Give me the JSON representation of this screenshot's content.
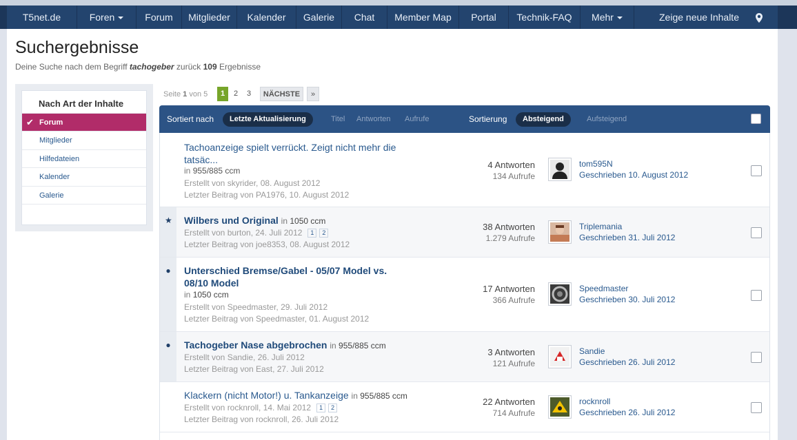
{
  "nav": {
    "items": [
      {
        "label": "T5net.de",
        "caret": false
      },
      {
        "label": "Foren",
        "caret": true
      },
      {
        "label": "Forum",
        "caret": false
      },
      {
        "label": "Mitglieder",
        "caret": false
      },
      {
        "label": "Kalender",
        "caret": false
      },
      {
        "label": "Galerie",
        "caret": false
      },
      {
        "label": "Chat",
        "caret": false
      },
      {
        "label": "Member Map",
        "caret": false
      },
      {
        "label": "Portal",
        "caret": false
      },
      {
        "label": "Technik-FAQ",
        "caret": false
      },
      {
        "label": "Mehr",
        "caret": true
      }
    ],
    "new_content": "Zeige neue Inhalte",
    "location_icon": "map-marker-icon"
  },
  "page": {
    "title": "Suchergebnisse",
    "sub_prefix": "Deine Suche nach dem Begriff",
    "term": "tachogeber",
    "sub_mid": "zurück",
    "count": "109",
    "sub_suffix": "Ergebnisse"
  },
  "sidebar": {
    "title": "Nach Art der Inhalte",
    "items": [
      "Forum",
      "Mitglieder",
      "Hilfedateien",
      "Kalender",
      "Galerie"
    ],
    "active_index": 0
  },
  "pagination": {
    "label_prefix": "Seite",
    "current": "1",
    "label_mid": "von",
    "total": "5",
    "pages": [
      "1",
      "2",
      "3"
    ],
    "next": "NÄCHSTE",
    "last": "»"
  },
  "sort": {
    "label": "Sortiert nach",
    "active": "Letzte Aktualisierung",
    "options": [
      "Titel",
      "Antworten",
      "Aufrufe"
    ],
    "order_label": "Sortierung",
    "order_active": "Absteigend",
    "order_other": "Aufsteigend"
  },
  "results": [
    {
      "title": "Tachoanzeige spielt verrückt. Zeigt nicht mehr die tatsäc...",
      "bold": false,
      "forum_prefix": "in",
      "forum": "955/885 ccm",
      "created": "Erstellt von skyrider, 08. August 2012",
      "last": "Letzter Beitrag von PA1976, 10. August 2012",
      "answers": "4 Antworten",
      "views": "134 Aufrufe",
      "user": "tom595N",
      "date": "Geschrieben 10. August 2012",
      "marker": "",
      "pages": []
    },
    {
      "title": "Wilbers und Original",
      "bold": true,
      "forum_prefix": "in",
      "forum": "1050 ccm",
      "created": "Erstellt von burton, 24. Juli 2012",
      "last": "Letzter Beitrag von joe8353, 08. August 2012",
      "answers": "38 Antworten",
      "views": "1.279 Aufrufe",
      "user": "Triplemania",
      "date": "Geschrieben 31. Juli 2012",
      "marker": "★",
      "pages": [
        "1",
        "2"
      ]
    },
    {
      "title": "Unterschied Bremse/Gabel - 05/07 Model vs. 08/10 Model",
      "bold": true,
      "forum_prefix": "in",
      "forum": "1050 ccm",
      "created": "Erstellt von Speedmaster, 29. Juli 2012",
      "last": "Letzter Beitrag von Speedmaster, 01. August 2012",
      "answers": "17 Antworten",
      "views": "366 Aufrufe",
      "user": "Speedmaster",
      "date": "Geschrieben 30. Juli 2012",
      "marker": "●",
      "pages": []
    },
    {
      "title": "Tachogeber Nase abgebrochen",
      "bold": true,
      "forum_prefix": "in",
      "forum": "955/885 ccm",
      "created": "Erstellt von Sandie, 26. Juli 2012",
      "last": "Letzter Beitrag von East, 27. Juli 2012",
      "answers": "3 Antworten",
      "views": "121 Aufrufe",
      "user": "Sandie",
      "date": "Geschrieben 26. Juli 2012",
      "marker": "●",
      "pages": []
    },
    {
      "title": "Klackern (nicht Motor!) u. Tankanzeige",
      "bold": false,
      "forum_prefix": "in",
      "forum": "955/885 ccm",
      "created": "Erstellt von rocknroll, 14. Mai 2012",
      "last": "Letzter Beitrag von rocknroll, 26. Juli 2012",
      "answers": "22 Antworten",
      "views": "714 Aufrufe",
      "user": "rocknroll",
      "date": "Geschrieben 26. Juli 2012",
      "marker": "",
      "pages": [
        "1",
        "2"
      ]
    }
  ]
}
